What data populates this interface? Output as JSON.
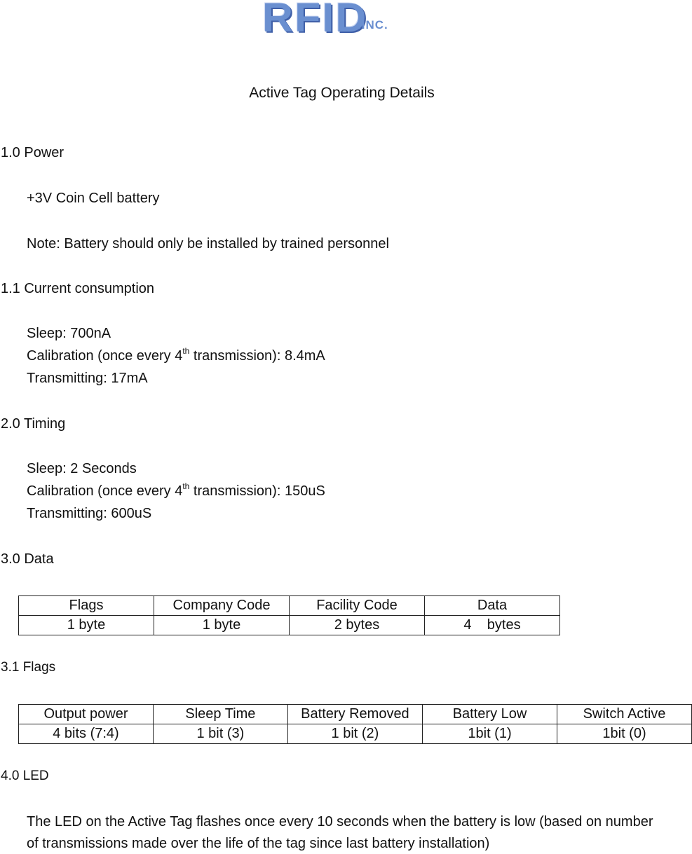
{
  "logo": {
    "main": "RFID",
    "suffix": ".INC.",
    "color": "#6a8fd0"
  },
  "title": "Active Tag Operating Details",
  "sections": {
    "power": {
      "heading": "1.0  Power",
      "battery": "+3V Coin Cell battery",
      "note": "Note: Battery should only be installed by trained personnel"
    },
    "current": {
      "heading": "1.1 Current consumption",
      "sleep": "Sleep: 700nA",
      "calibration_prefix": "Calibration (once every 4",
      "calibration_sup": "th",
      "calibration_suffix": " transmission): 8.4mA",
      "transmitting": "Transmitting: 17mA"
    },
    "timing": {
      "heading": "2.0  Timing",
      "sleep": "Sleep: 2 Seconds",
      "calibration_prefix": "Calibration (once every 4",
      "calibration_sup": "th",
      "calibration_suffix": " transmission): 150uS",
      "transmitting": "Transmitting: 600uS"
    },
    "data": {
      "heading": "3.0  Data",
      "table": {
        "headers": [
          "Flags",
          "Company Code",
          "Facility Code",
          "Data"
        ],
        "values": [
          "1 byte",
          "1 byte",
          "2 bytes",
          "4    bytes"
        ]
      }
    },
    "flags": {
      "heading": "3.1 Flags",
      "table": {
        "headers": [
          "Output power",
          "Sleep Time",
          "Battery Removed",
          "Battery Low",
          "Switch Active"
        ],
        "values": [
          "4 bits (7:4)",
          "1 bit (3)",
          "1 bit (2)",
          "1bit (1)",
          "1bit (0)"
        ]
      }
    },
    "led": {
      "heading": "4.0 LED",
      "line1": "The LED on the Active Tag flashes once every 10 seconds when the battery is low (based on number",
      "line2": "of transmissions made over the life of the tag since last battery installation)"
    }
  }
}
